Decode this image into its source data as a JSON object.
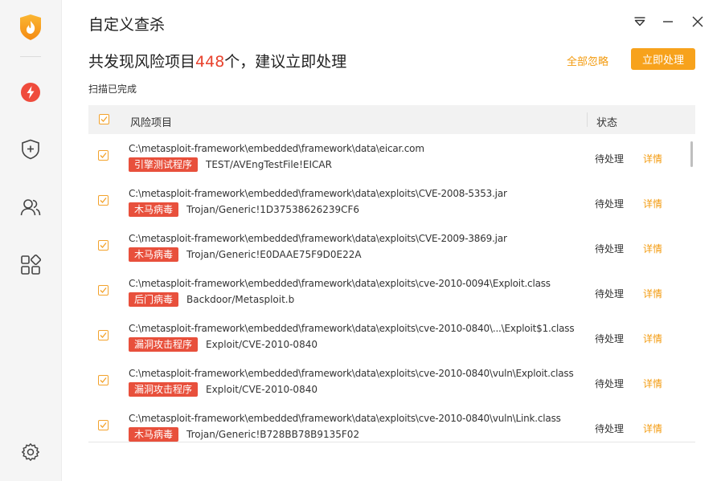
{
  "window": {
    "title": "自定义查杀",
    "controls": [
      "menu-icon",
      "minimize-icon",
      "close-icon"
    ]
  },
  "sidebar": {
    "items": [
      {
        "icon": "lightning-icon",
        "name": "quick-scan"
      },
      {
        "icon": "shield-plus-icon",
        "name": "protection"
      },
      {
        "icon": "users-icon",
        "name": "accounts"
      },
      {
        "icon": "apps-icon",
        "name": "toolbox"
      },
      {
        "icon": "gear-icon",
        "name": "settings"
      }
    ]
  },
  "summary": {
    "prefix": "共发现风险项目",
    "count": "448",
    "suffix": "个，建议立即处理",
    "status_text": "扫描已完成",
    "ignore_all_label": "全部忽略",
    "process_now_label": "立即处理"
  },
  "table": {
    "header": {
      "name": "风险项目",
      "status": "状态"
    },
    "rows": [
      {
        "path": "C:\\metasploit-framework\\embedded\\framework\\data\\eicar.com",
        "tag": "引擎测试程序",
        "threat": "TEST/AVEngTestFile!EICAR",
        "status": "待处理",
        "action": "详情"
      },
      {
        "path": "C:\\metasploit-framework\\embedded\\framework\\data\\exploits\\CVE-2008-5353.jar",
        "tag": "木马病毒",
        "threat": "Trojan/Generic!1D37538626239CF6",
        "status": "待处理",
        "action": "详情"
      },
      {
        "path": "C:\\metasploit-framework\\embedded\\framework\\data\\exploits\\CVE-2009-3869.jar",
        "tag": "木马病毒",
        "threat": "Trojan/Generic!E0DAAE75F9D0E22A",
        "status": "待处理",
        "action": "详情"
      },
      {
        "path": "C:\\metasploit-framework\\embedded\\framework\\data\\exploits\\cve-2010-0094\\Exploit.class",
        "tag": "后门病毒",
        "threat": "Backdoor/Metasploit.b",
        "status": "待处理",
        "action": "详情"
      },
      {
        "path": "C:\\metasploit-framework\\embedded\\framework\\data\\exploits\\cve-2010-0840\\...\\Exploit$1.class",
        "tag": "漏洞攻击程序",
        "threat": "Exploit/CVE-2010-0840",
        "status": "待处理",
        "action": "详情"
      },
      {
        "path": "C:\\metasploit-framework\\embedded\\framework\\data\\exploits\\cve-2010-0840\\vuln\\Exploit.class",
        "tag": "漏洞攻击程序",
        "threat": "Exploit/CVE-2010-0840",
        "status": "待处理",
        "action": "详情"
      },
      {
        "path": "C:\\metasploit-framework\\embedded\\framework\\data\\exploits\\cve-2010-0840\\vuln\\Link.class",
        "tag": "木马病毒",
        "threat": "Trojan/Generic!B728BB78B9135F02",
        "status": "待处理",
        "action": "详情"
      }
    ]
  },
  "colors": {
    "accent": "#f7a21c",
    "danger": "#e8503c",
    "count": "#e8432e",
    "link": "#f39b0f"
  }
}
